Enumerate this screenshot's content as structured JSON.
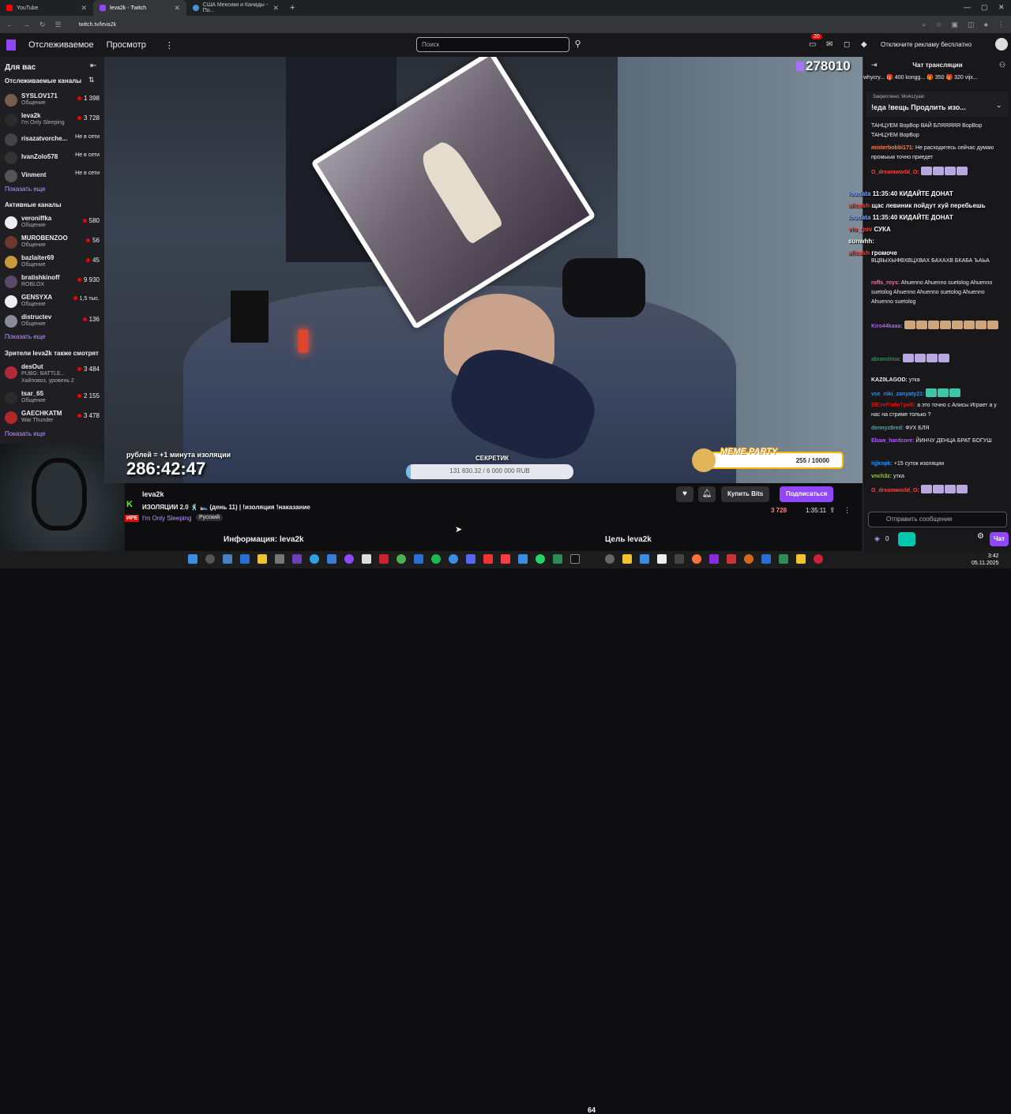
{
  "browser": {
    "tabs": [
      {
        "label": "YouTube",
        "color": "#ff0000"
      },
      {
        "label": "leva2k - Twitch",
        "color": "#9147ff"
      },
      {
        "label": "США Мексики и Канады - По...",
        "color": "#4a90d9"
      }
    ],
    "url": "twitch.tv/leva2k"
  },
  "nav": {
    "following": "Отслеживаемое",
    "browse": "Просмотр",
    "more": "⋮",
    "search_placeholder": "Поиск",
    "notif_count": "20",
    "ad_free": "Отключите рекламу бесплатно"
  },
  "sidebar": {
    "for_you": "Для вас",
    "followed_title": "Отслеживаемые каналы",
    "followed": [
      {
        "name": "SYSLOV171",
        "cat": "Общение",
        "count": "1 398",
        "live": true
      },
      {
        "name": "leva2k",
        "cat": "I'm Only Sleeping",
        "count": "3 728",
        "live": true
      },
      {
        "name": "risazatvorche...",
        "cat": "",
        "count": "Не в сети",
        "live": false
      },
      {
        "name": "IvanZolo578",
        "cat": "",
        "count": "Не в сети",
        "live": false
      },
      {
        "name": "Vinment",
        "cat": "",
        "count": "Не в сети",
        "live": false
      }
    ],
    "show_more": "Показать еще",
    "active_title": "Активные каналы",
    "active": [
      {
        "name": "veroniffka",
        "cat": "Общение",
        "count": "580"
      },
      {
        "name": "MUROBENZOO",
        "cat": "Общение",
        "count": "56"
      },
      {
        "name": "bazlaiter69",
        "cat": "Общение",
        "count": "45"
      },
      {
        "name": "bratishkinoff",
        "cat": "ROBLOX",
        "count": "9 930"
      },
      {
        "name": "GENSYXA",
        "cat": "Общение",
        "count": "1,5 тыс."
      },
      {
        "name": "distructev",
        "cat": "Общение",
        "count": "136"
      }
    ],
    "viewers_title": "Зрители leva2k также смотрят",
    "viewers_also": [
      {
        "name": "desOut",
        "cat": "PUBG: BATTLE...",
        "extra": "Хайповоз, уровень 2",
        "count": "3 484"
      },
      {
        "name": "tsar_65",
        "cat": "Общение",
        "extra": "",
        "count": "2 155"
      },
      {
        "name": "GAECHKATM",
        "cat": "War Thunder",
        "extra": "",
        "count": "3 478"
      }
    ]
  },
  "video": {
    "viewer_count": "278010",
    "timer_label": "рублей = +1 минута изоляции",
    "timer_value": "286:42:47",
    "goal_title": "СЕКРЕТИК",
    "goal_text": "131 830.32 / 6 000 000 RUB",
    "goal_progress": 0.022,
    "meme_title": "MEME PARTY",
    "meme_value": "255 / 10000"
  },
  "stream": {
    "streamer": "leva2k",
    "title": "ИЗОЛЯЦИИ 2.0 🕺 🛌 (день 11) | !изоляция !наказание",
    "live_label": "ИРЕ",
    "category": "I'm Only Sleeping",
    "language": "Русский",
    "bits_label": "Купить Bits",
    "sub_label": "Подписаться",
    "viewers": "3 728",
    "uptime": "1:35:11",
    "about": "Информация: leva2k",
    "goal": "Цель leva2k"
  },
  "chat": {
    "header": "Чат трансляции",
    "gifters": "whycry... 🎁 400  kongg... 🎁 350  🎁 320  vijx...",
    "pinned_by": "Закреплено: Mo4ozyain",
    "pinned_text": "!еда !вещь Продлить изо...",
    "messages": [
      {
        "user": "",
        "text": "ТАНЦУЕМ ВорВор ВАЙ БЛЯЯЯЯЯ ВорВор ТАНЦУЕМ ВорВор",
        "color": "#efeff1"
      },
      {
        "user": "misterbobbi171:",
        "text": "Не расходитесь сейчас думаю промыьм точно приедет",
        "color": "#ff7f50"
      },
      {
        "user": "O_dreamworld_O:",
        "text": "",
        "color": "#ff4040"
      },
      {
        "user": "",
        "text": "ВЦВЫХЫФВХВЦХВАХ БАХАХВ БКАБА ЪАЬА",
        "color": "#efeff1"
      },
      {
        "user": "rofls_roys:",
        "text": "Ahuenno Ahuenno suetolog Ahuenno suetolog Ahuenno Ahuenno suetolog Ahuenno Ahuenno suetolog",
        "color": "#ff69b4"
      },
      {
        "user": "Kiro44kaaa:",
        "text": "",
        "color": "#b05cff"
      },
      {
        "user": "abramtima:",
        "text": "",
        "color": "#2e8b57"
      },
      {
        "user": "KAZ0LAGOD:",
        "text": "утка",
        "color": "#efeff1"
      },
      {
        "user": "vse_niki_zanyaty21:",
        "text": "",
        "color": "#1e90ff"
      },
      {
        "user": "ElCeHTu6eTpeB:",
        "text": "а это точно с Алисы Играет а у нас на стриме только ?",
        "color": "#eb0400"
      },
      {
        "user": "dennyz8red:",
        "text": "ФУХ БЛЯ",
        "color": "#5f9ea0"
      },
      {
        "user": "Ebaw_hardcore:",
        "text": "ЙИНЧУ ДЕНЦА БРАТ БОГУШ",
        "color": "#b05cff"
      },
      {
        "user": "hjjkopk:",
        "text": "+15 суток изоляции",
        "color": "#1e90ff"
      },
      {
        "user": "vnch3z:",
        "text": "утка",
        "color": "#9acd32"
      },
      {
        "user": "O_dreamworld_O:",
        "text": "",
        "color": "#ff4040"
      }
    ],
    "overlay_lines": [
      {
        "user": "loudata",
        "text": "11:35:40 КИДАЙТЕ ДОНАТ",
        "color": "#7aa8ff"
      },
      {
        "user": "alicash",
        "text": "щас левиник пойдут хуй перебьешь",
        "color": "#ff4040"
      },
      {
        "user": "loudata",
        "text": "11:35:40 КИДАЙТЕ ДОНАТ",
        "color": "#7aa8ff"
      },
      {
        "user": "vio_gov",
        "text": "СУКА",
        "color": "#ff4040"
      },
      {
        "user": "sunwhh:",
        "text": "",
        "color": "#ffffff"
      },
      {
        "user": "alicash",
        "text": "громоче",
        "color": "#ff4040"
      }
    ],
    "input_placeholder": "Отправить сообщение",
    "points": "0",
    "chat_button": "Чат"
  },
  "taskbar": {
    "time": "3:42",
    "date": "05.11.2025",
    "badge": "64"
  }
}
